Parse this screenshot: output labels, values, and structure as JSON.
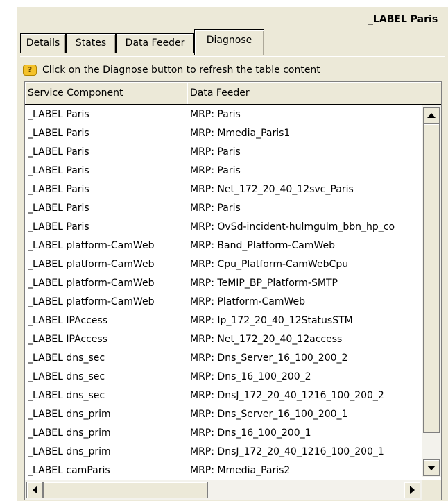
{
  "window": {
    "title": "_LABEL Paris"
  },
  "tabs": [
    {
      "label": "Details"
    },
    {
      "label": "States"
    },
    {
      "label": "Data Feeder"
    },
    {
      "label": "Diagnose",
      "active": true
    }
  ],
  "info": {
    "icon": "question-icon",
    "text": "Click on the Diagnose button to refresh the table content"
  },
  "table": {
    "columns": [
      "Service Component",
      "Data Feeder"
    ],
    "rows": [
      [
        "_LABEL Paris",
        "MRP: Paris"
      ],
      [
        "_LABEL Paris",
        "MRP: Mmedia_Paris1"
      ],
      [
        "_LABEL Paris",
        "MRP: Paris"
      ],
      [
        "_LABEL Paris",
        "MRP: Paris"
      ],
      [
        "_LABEL Paris",
        "MRP: Net_172_20_40_12svc_Paris"
      ],
      [
        "_LABEL Paris",
        "MRP: Paris"
      ],
      [
        "_LABEL Paris",
        "MRP: OvSd-incident-hulmgulm_bbn_hp_co"
      ],
      [
        "_LABEL platform-CamWeb",
        "MRP: Band_Platform-CamWeb"
      ],
      [
        "_LABEL platform-CamWeb",
        "MRP: Cpu_Platform-CamWebCpu"
      ],
      [
        "_LABEL platform-CamWeb",
        "MRP: TeMIP_BP_Platform-SMTP"
      ],
      [
        "_LABEL platform-CamWeb",
        "MRP: Platform-CamWeb"
      ],
      [
        "_LABEL IPAccess",
        "MRP: Ip_172_20_40_12StatusSTM"
      ],
      [
        "_LABEL IPAccess",
        "MRP: Net_172_20_40_12access"
      ],
      [
        "_LABEL dns_sec",
        "MRP: Dns_Server_16_100_200_2"
      ],
      [
        "_LABEL dns_sec",
        "MRP: Dns_16_100_200_2"
      ],
      [
        "_LABEL dns_sec",
        "MRP: DnsJ_172_20_40_1216_100_200_2"
      ],
      [
        "_LABEL dns_prim",
        "MRP: Dns_Server_16_100_200_1"
      ],
      [
        "_LABEL dns_prim",
        "MRP: Dns_16_100_200_1"
      ],
      [
        "_LABEL dns_prim",
        "MRP: DnsJ_172_20_40_1216_100_200_1"
      ],
      [
        "_LABEL camParis",
        "MRP: Mmedia_Paris2"
      ]
    ]
  },
  "colors": {
    "panel": "#ece9d8",
    "grid_bg": "#ffffff"
  }
}
